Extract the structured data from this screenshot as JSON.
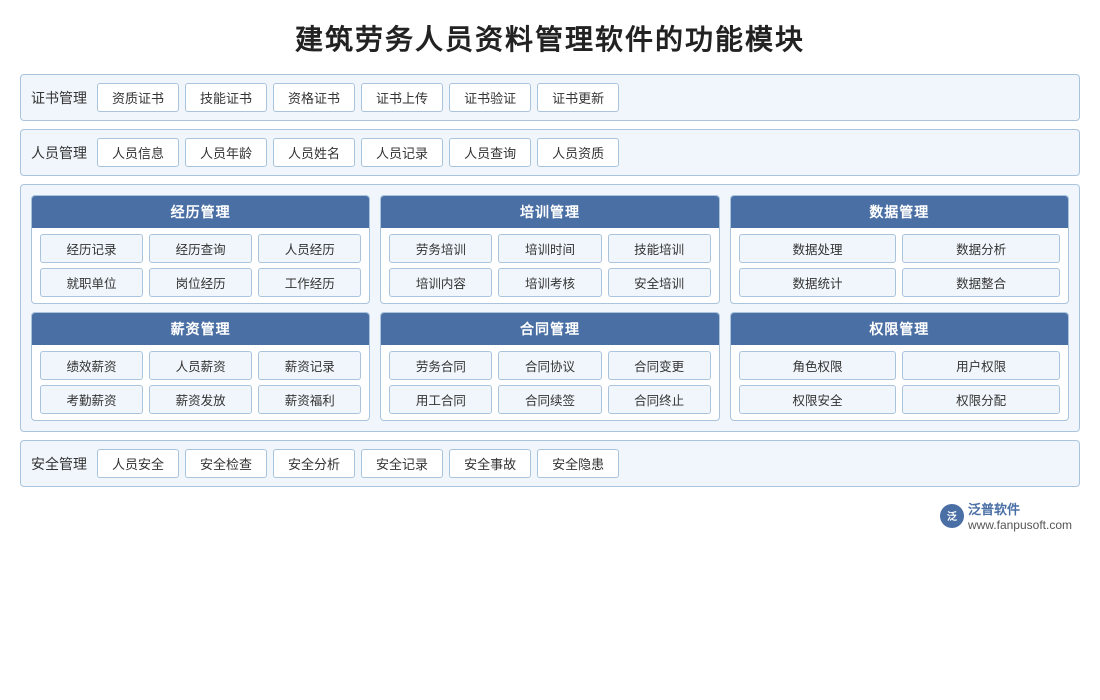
{
  "title": "建筑劳务人员资料管理软件的功能模块",
  "cert_section": {
    "label": "证书管理",
    "tags": [
      "资质证书",
      "技能证书",
      "资格证书",
      "证书上传",
      "证书验证",
      "证书更新"
    ]
  },
  "personnel_section": {
    "label": "人员管理",
    "tags": [
      "人员信息",
      "人员年龄",
      "人员姓名",
      "人员记录",
      "人员查询",
      "人员资质"
    ]
  },
  "middle_top": [
    {
      "header": "经历管理",
      "rows": [
        [
          "经历记录",
          "经历查询",
          "人员经历"
        ],
        [
          "就职单位",
          "岗位经历",
          "工作经历"
        ]
      ]
    },
    {
      "header": "培训管理",
      "rows": [
        [
          "劳务培训",
          "培训时间",
          "技能培训"
        ],
        [
          "培训内容",
          "培训考核",
          "安全培训"
        ]
      ]
    },
    {
      "header": "数据管理",
      "rows": [
        [
          "数据处理",
          "数据分析"
        ],
        [
          "数据统计",
          "数据整合"
        ]
      ]
    }
  ],
  "middle_bottom": [
    {
      "header": "薪资管理",
      "rows": [
        [
          "绩效薪资",
          "人员薪资",
          "薪资记录"
        ],
        [
          "考勤薪资",
          "薪资发放",
          "薪资福利"
        ]
      ]
    },
    {
      "header": "合同管理",
      "rows": [
        [
          "劳务合同",
          "合同协议",
          "合同变更"
        ],
        [
          "用工合同",
          "合同续签",
          "合同终止"
        ]
      ]
    },
    {
      "header": "权限管理",
      "rows": [
        [
          "角色权限",
          "用户权限"
        ],
        [
          "权限安全",
          "权限分配"
        ]
      ]
    }
  ],
  "safety_section": {
    "label": "安全管理",
    "tags": [
      "人员安全",
      "安全检查",
      "安全分析",
      "安全记录",
      "安全事故",
      "安全隐患"
    ]
  },
  "brand": {
    "logo": "泛",
    "name": "泛普软件",
    "url": "www.fanpusoft.com"
  }
}
